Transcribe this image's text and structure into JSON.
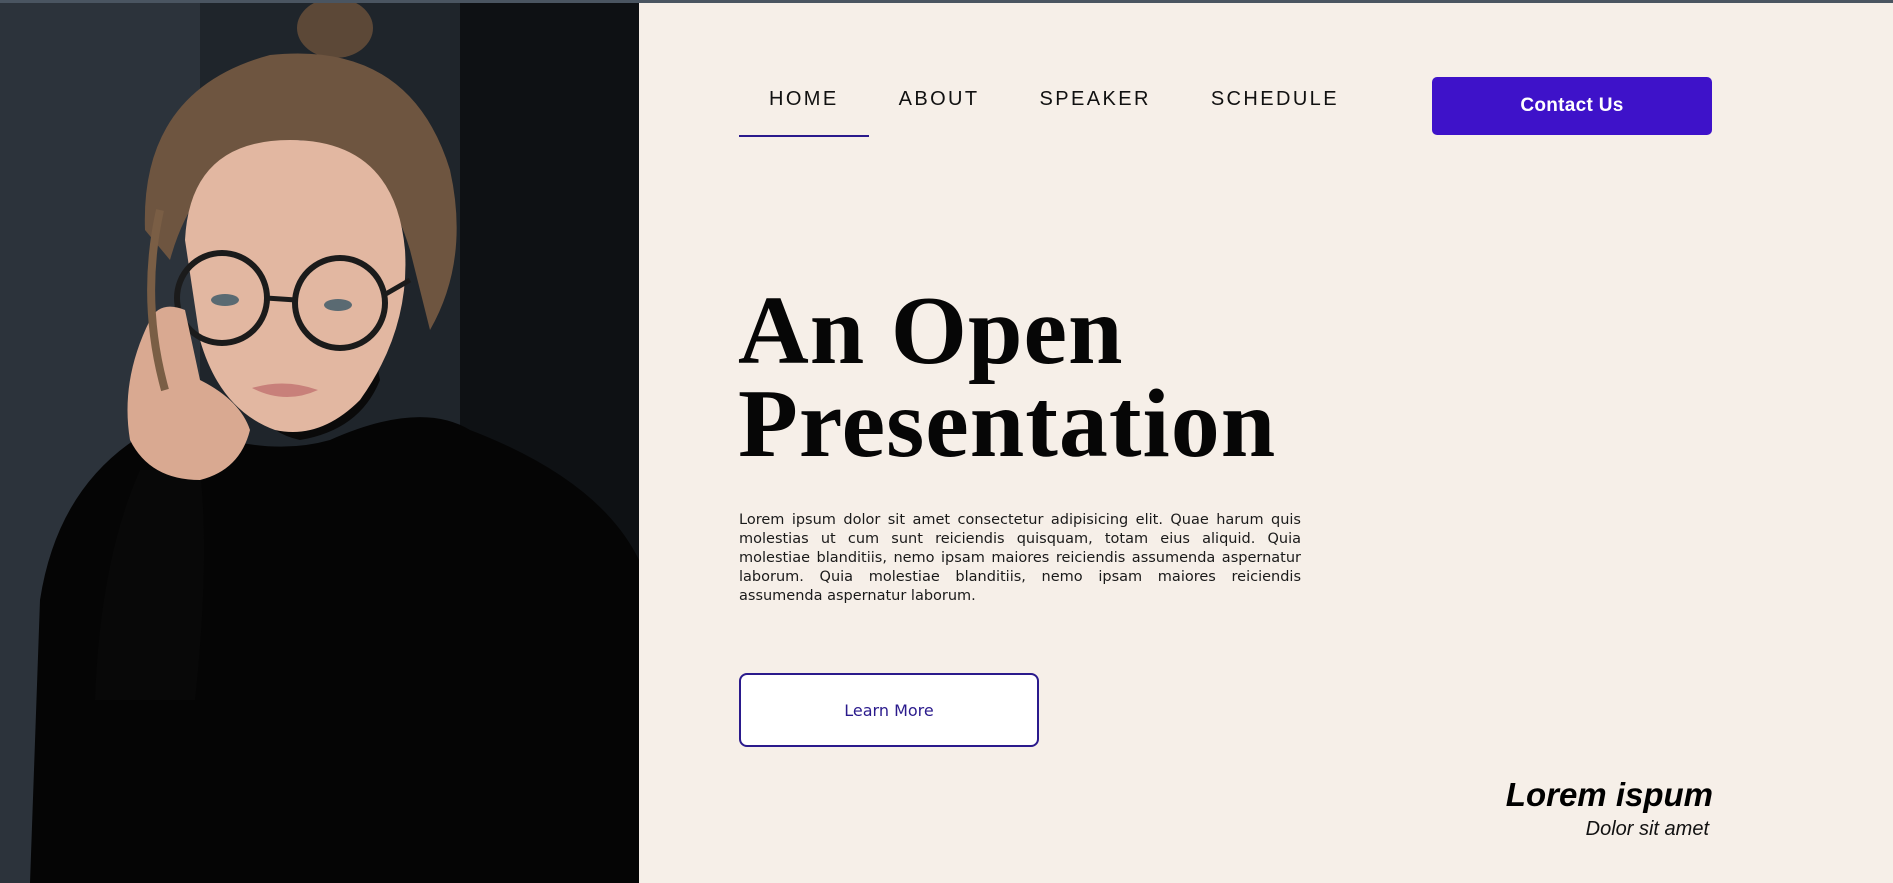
{
  "nav": {
    "items": [
      {
        "label": "HOME",
        "active": true
      },
      {
        "label": "ABOUT",
        "active": false
      },
      {
        "label": "SPEAKER",
        "active": false
      },
      {
        "label": "SCHEDULE",
        "active": false
      }
    ],
    "contact_label": "Contact Us"
  },
  "hero": {
    "title_line1": "An Open",
    "title_line2": "Presentation",
    "body": "Lorem ipsum dolor sit amet consectetur adipisicing elit. Quae harum quis molestias ut cum sunt reiciendis quisquam, totam eius aliquid. Quia molestiae blanditiis, nemo ipsam maiores reiciendis assumenda aspernatur laborum. Quia molestiae blanditiis, nemo ipsam maiores reiciendis assumenda aspernatur laborum.",
    "cta_label": "Learn More"
  },
  "caption": {
    "title": "Lorem ispum",
    "subtitle": "Dolor sit amet"
  },
  "photo": {
    "subject": "speaker-portrait-woman-with-glasses"
  },
  "colors": {
    "background": "#f6efe8",
    "accent": "#3e12c9",
    "accent_dark": "#2a1a8c",
    "text": "#060606"
  }
}
